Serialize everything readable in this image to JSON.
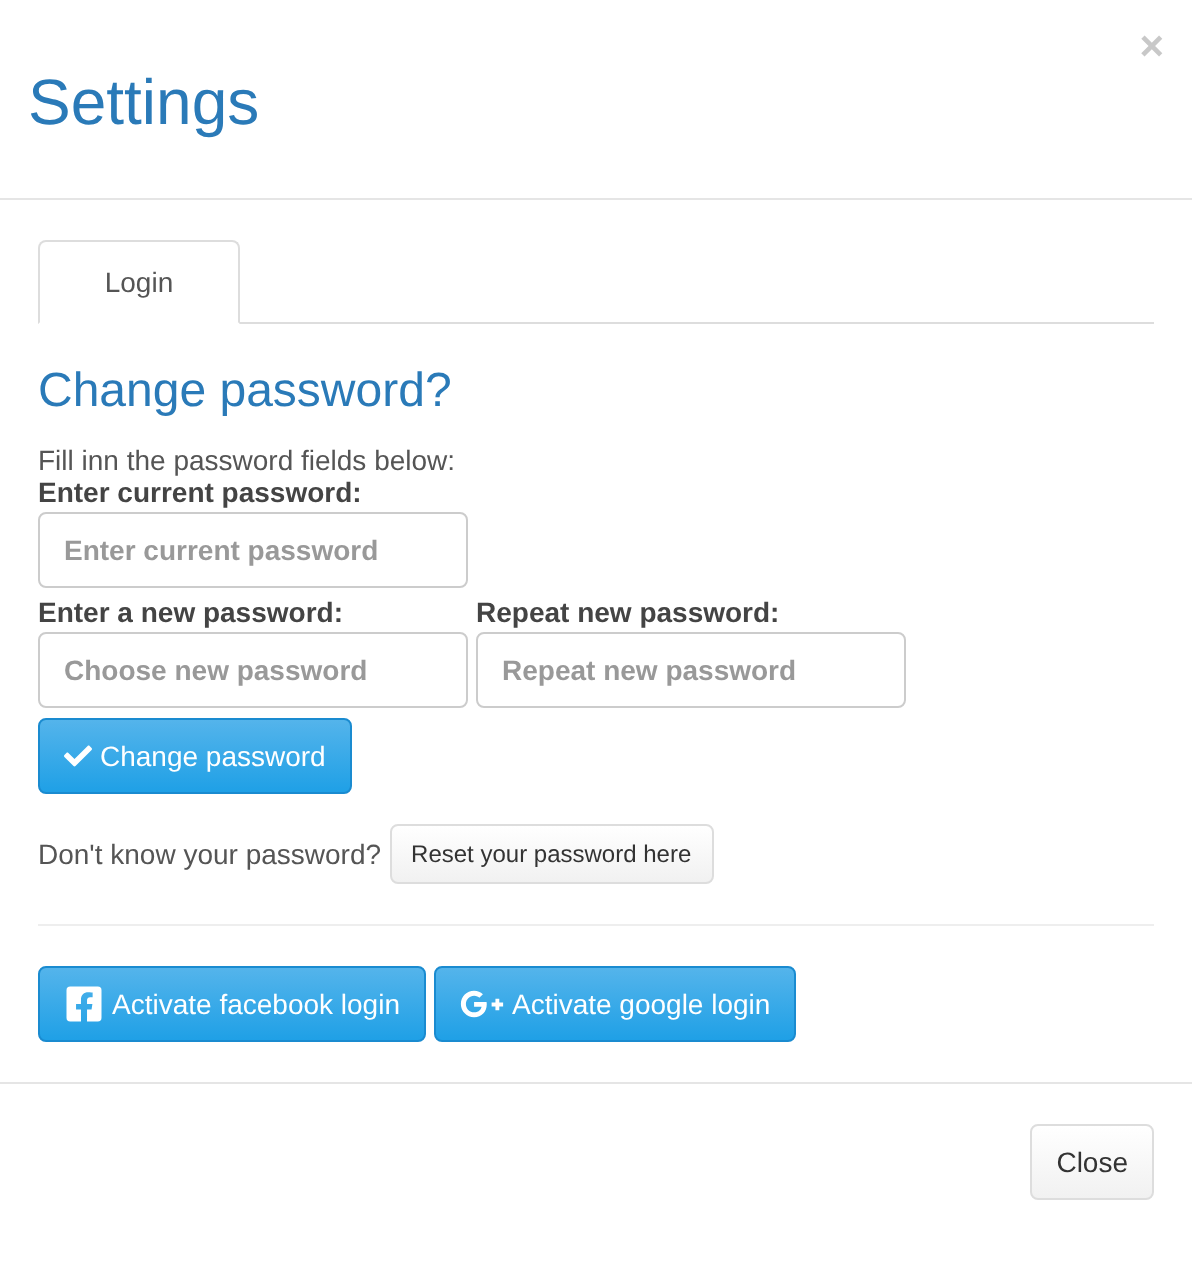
{
  "modal": {
    "title": "Settings",
    "close_glyph": "×"
  },
  "tabs": [
    {
      "label": "Login",
      "selected": true
    }
  ],
  "change_password": {
    "heading": "Change password?",
    "intro": "Fill inn the password fields below:",
    "fields": [
      {
        "label": "Enter current password:",
        "placeholder": "Enter current password"
      },
      {
        "label": "Enter a new password:",
        "placeholder": "Choose new password"
      },
      {
        "label": "Repeat new password:",
        "placeholder": "Repeat new password"
      }
    ],
    "submit": "Change password"
  },
  "reset": {
    "prompt": "Don't know your password?",
    "button": "Reset your password here"
  },
  "social_buttons": [
    {
      "kind": "facebook",
      "label": "Activate facebook login"
    },
    {
      "kind": "google",
      "label": "Activate google login"
    }
  ],
  "footer": {
    "button": "Close"
  }
}
